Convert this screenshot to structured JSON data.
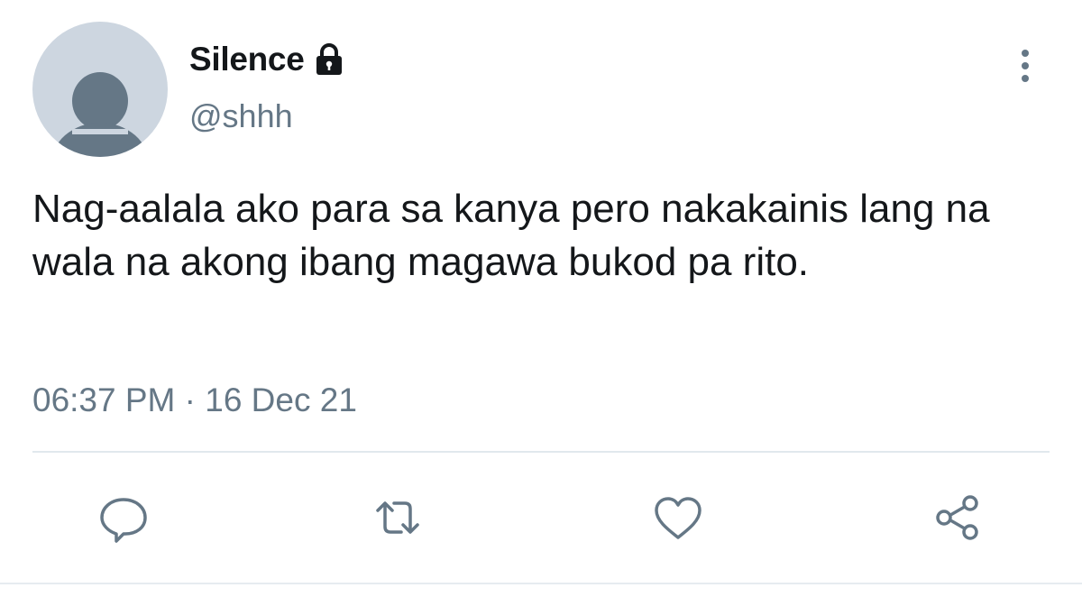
{
  "user": {
    "display_name": "Silence",
    "handle": "@shhh",
    "protected_icon": "lock-icon",
    "avatar_icon": "default-avatar-icon"
  },
  "tweet": {
    "text": "Nag-aalala ako para sa kanya pero nakakainis lang na wala na akong ibang magawa bukod pa rito.",
    "timestamp": "06:37 PM · 16 Dec 21"
  },
  "actions": [
    {
      "name": "reply",
      "icon": "comment-icon"
    },
    {
      "name": "retweet",
      "icon": "retweet-icon"
    },
    {
      "name": "like",
      "icon": "heart-icon"
    },
    {
      "name": "share",
      "icon": "share-icon"
    }
  ],
  "colors": {
    "text_primary": "#14171a",
    "text_secondary": "#657786",
    "icon": "#657786",
    "avatar_bg": "#cdd6e0",
    "avatar_fg": "#657786",
    "divider": "#e1e8ed"
  }
}
